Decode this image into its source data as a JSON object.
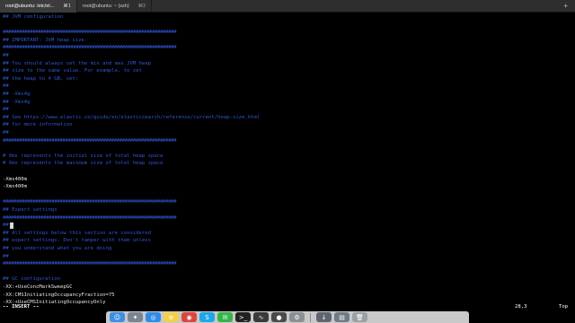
{
  "tabs": [
    {
      "title": "root@ubuntu: /etc/el...",
      "shortcut": "⌘1",
      "active": true
    },
    {
      "title": "root@ubuntu: ~ (ssh)",
      "shortcut": "⌘2",
      "active": false
    }
  ],
  "add_tab_symbol": "+",
  "editor": {
    "lines": [
      {
        "row": 0,
        "kind": "comment",
        "text": "## JVM configuration"
      },
      {
        "row": 2,
        "kind": "rule",
        "text": "################################################################"
      },
      {
        "row": 3,
        "kind": "comment",
        "text": "## IMPORTANT: JVM heap size"
      },
      {
        "row": 4,
        "kind": "rule",
        "text": "################################################################"
      },
      {
        "row": 5,
        "kind": "comment",
        "text": "##"
      },
      {
        "row": 6,
        "kind": "comment",
        "text": "## You should always set the min and max JVM heap"
      },
      {
        "row": 7,
        "kind": "comment",
        "text": "## size to the same value. For example, to set"
      },
      {
        "row": 8,
        "kind": "comment",
        "text": "## the heap to 4 GB, set:"
      },
      {
        "row": 9,
        "kind": "comment",
        "text": "##"
      },
      {
        "row": 10,
        "kind": "comment",
        "text": "## -Xms4g"
      },
      {
        "row": 11,
        "kind": "comment",
        "text": "## -Xmx4g"
      },
      {
        "row": 12,
        "kind": "comment",
        "text": "##"
      },
      {
        "row": 13,
        "kind": "comment",
        "text": "## See https://www.elastic.co/guide/en/elasticsearch/reference/current/heap-size.html"
      },
      {
        "row": 14,
        "kind": "comment",
        "text": "## for more information"
      },
      {
        "row": 15,
        "kind": "comment",
        "text": "##"
      },
      {
        "row": 16,
        "kind": "rule",
        "text": "################################################################"
      },
      {
        "row": 18,
        "kind": "comment",
        "text": "# Xms represents the initial size of total heap space"
      },
      {
        "row": 19,
        "kind": "comment",
        "text": "# Xmx represents the maximum size of total heap space"
      },
      {
        "row": 21,
        "kind": "code",
        "text": "-Xms400m"
      },
      {
        "row": 22,
        "kind": "code",
        "text": "-Xmx400m"
      },
      {
        "row": 24,
        "kind": "rule",
        "text": "################################################################"
      },
      {
        "row": 25,
        "kind": "comment",
        "text": "## Expert settings"
      },
      {
        "row": 26,
        "kind": "rule",
        "text": "################################################################"
      },
      {
        "row": 27,
        "kind": "comment",
        "text": "##"
      },
      {
        "row": 28,
        "kind": "comment",
        "text": "## All settings below this section are considered"
      },
      {
        "row": 29,
        "kind": "comment",
        "text": "## expert settings. Don't tamper with them unless"
      },
      {
        "row": 30,
        "kind": "comment",
        "text": "## you understand what you are doing"
      },
      {
        "row": 31,
        "kind": "comment",
        "text": "##"
      },
      {
        "row": 32,
        "kind": "rule",
        "text": "################################################################"
      },
      {
        "row": 34,
        "kind": "comment",
        "text": "## GC configuration"
      },
      {
        "row": 35,
        "kind": "code",
        "text": "-XX:+UseConcMarkSweepGC"
      },
      {
        "row": 36,
        "kind": "code",
        "text": "-XX:CMSInitiatingOccupancyFraction=75"
      },
      {
        "row": 37,
        "kind": "code",
        "text": "-XX:+UseCMSInitiatingOccupancyOnly"
      }
    ],
    "cursor_row": 27
  },
  "status": {
    "mode": "-- INSERT --",
    "position": "28,3",
    "scroll": "Top"
  },
  "dock": {
    "items": [
      {
        "name": "finder-icon",
        "color": "#3d8fe0",
        "glyph": "☺"
      },
      {
        "name": "launchpad-icon",
        "color": "#7b8591",
        "glyph": "✦"
      },
      {
        "name": "safari-icon",
        "color": "#2f8be8",
        "glyph": "◎"
      },
      {
        "name": "notes-icon",
        "color": "#f2d04a",
        "glyph": "≡"
      },
      {
        "name": "chrome-icon",
        "color": "#d9473c",
        "glyph": "◉"
      },
      {
        "name": "skype-icon",
        "color": "#1fa6e8",
        "glyph": "S"
      },
      {
        "name": "messages-icon",
        "color": "#35b44a",
        "glyph": "✉"
      },
      {
        "name": "terminal-icon",
        "color": "#222222",
        "glyph": ">_"
      },
      {
        "name": "activity-monitor-icon",
        "color": "#3a3a3a",
        "glyph": "∿"
      },
      {
        "name": "camera-icon",
        "color": "#4a4a4a",
        "glyph": "●"
      },
      {
        "name": "system-preferences-icon",
        "color": "#8a8f96",
        "glyph": "⚙"
      },
      {
        "name": "sep",
        "color": "",
        "glyph": ""
      },
      {
        "name": "downloads-icon",
        "color": "#5d6670",
        "glyph": "↓"
      },
      {
        "name": "documents-icon",
        "color": "#6e7a86",
        "glyph": "▤"
      },
      {
        "name": "trash-icon",
        "color": "#9aa0a6",
        "glyph": "🗑"
      }
    ]
  }
}
